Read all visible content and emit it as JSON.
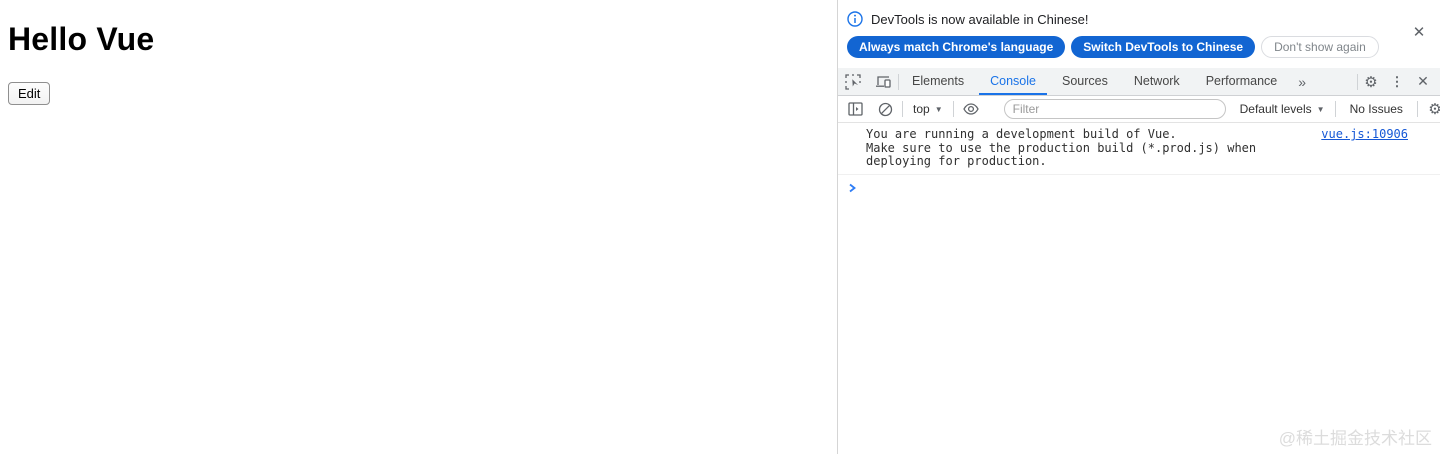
{
  "page": {
    "title": "Hello Vue",
    "edit_button_label": "Edit"
  },
  "devtools": {
    "infobar": {
      "message": "DevTools is now available in Chinese!",
      "buttons": [
        {
          "label": "Always match Chrome's language"
        },
        {
          "label": "Switch DevTools to Chinese"
        },
        {
          "label": "Don't show again"
        }
      ]
    },
    "tabs": [
      "Elements",
      "Console",
      "Sources",
      "Network",
      "Performance"
    ],
    "active_tab": "Console",
    "console": {
      "context_selector": "top",
      "filter_placeholder": "Filter",
      "levels_label": "Default levels",
      "issues_label": "No Issues",
      "message": {
        "line1": "You are running a development build of Vue.",
        "line2": "Make sure to use the production build (*.prod.js) when deploying for production.",
        "source_link": "vue.js:10906"
      }
    }
  },
  "icons": {
    "close_x": "✕",
    "gear": "⚙",
    "kebab": "⋮",
    "more_tabs": "»",
    "caret_down": "▼"
  },
  "colors": {
    "primary_button_blue": "#1265d2",
    "active_tab_blue": "#1a73e8",
    "link_blue": "#1558d6",
    "icon_gray": "#5f6368",
    "watermark_gray": "#dcdcdc"
  },
  "watermark": "@稀土掘金技术社区"
}
